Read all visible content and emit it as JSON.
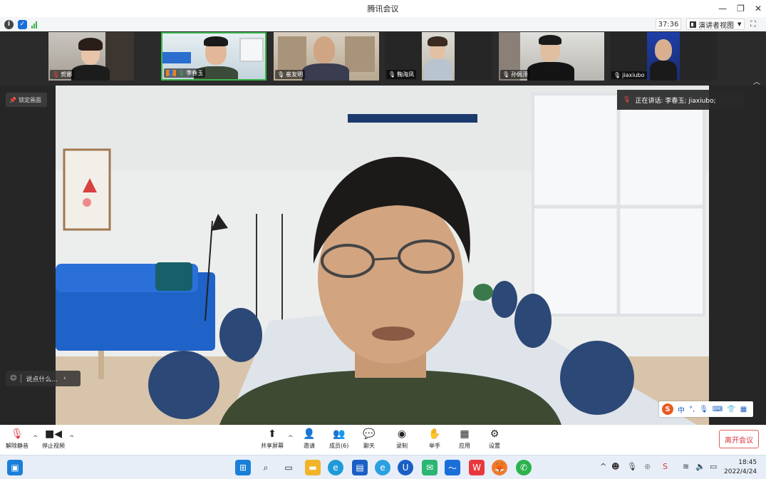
{
  "window": {
    "title": "腾讯会议",
    "minimize": "—",
    "restore": "❐",
    "close": "✕"
  },
  "status": {
    "timer": "37:36",
    "view_mode": "演讲者视图"
  },
  "participants": [
    {
      "name": "贺娜",
      "mic": "muted"
    },
    {
      "name": "李春玉",
      "mic": "active"
    },
    {
      "name": "崔友明",
      "mic": "on"
    },
    {
      "name": "鞠海凤",
      "mic": "on"
    },
    {
      "name": "孙佩泽",
      "mic": "on"
    },
    {
      "name": "jiaxiubo",
      "mic": "on"
    }
  ],
  "stage": {
    "lock_label": "锁定画面",
    "speaking_label": "正在讲话: 李春玉; jiaxiubo;",
    "chat_placeholder": "说点什么...",
    "main_speaker": "李春玉"
  },
  "ime": {
    "lang": "中",
    "punct": "°,"
  },
  "toolbar": {
    "unmute": "解除静音",
    "stop_video": "停止视频",
    "share": "共享屏幕",
    "invite": "邀请",
    "members": "成员(6)",
    "chat": "聊天",
    "record": "录制",
    "raise_hand": "举手",
    "apps": "应用",
    "settings": "设置",
    "leave": "离开会议"
  },
  "taskbar": {
    "time": "18:45",
    "date": "2022/4/24"
  },
  "colors": {
    "accent": "#1a5fc4",
    "leave": "#d9363e",
    "mic_active": "#3bb54a"
  }
}
